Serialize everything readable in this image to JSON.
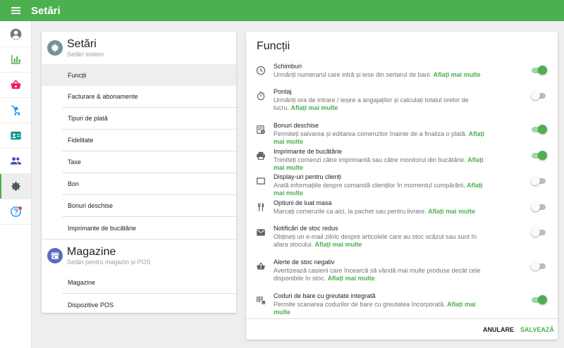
{
  "topbar": {
    "title": "Setări"
  },
  "colors": {
    "accent": "#4caf50",
    "nav_icons": [
      "#757575",
      "#4caf50",
      "#e91e63",
      "#2196f3",
      "#009688",
      "#3f51b5",
      "#455a64",
      "#2196f3"
    ],
    "section_settings": "#78909c",
    "section_stores": "#5c6bc0"
  },
  "nav": {
    "items": [
      "account-icon",
      "reports-icon",
      "items-icon",
      "employees-icon",
      "customers-icon",
      "users-icon",
      "settings-icon",
      "help-icon"
    ]
  },
  "settings": {
    "title": "Setări",
    "subtitle": "Setări sistem",
    "items": [
      "Funcții",
      "Facturare & abonamente",
      "Tipuri de plată",
      "Fidelitate",
      "Taxe",
      "Bon",
      "Bonuri deschise",
      "Imprimante de bucătărie"
    ]
  },
  "stores": {
    "title": "Magazine",
    "subtitle": "Setări pentru magazin și POS",
    "items": [
      "Magazine",
      "Dispozitive POS"
    ]
  },
  "functions": {
    "title": "Funcții",
    "learn_more": "Aflați mai multe",
    "items": [
      {
        "title": "Schimburi",
        "desc": "Urmăriți numerarul care intră și iese din sertarul de bani.",
        "enabled": true,
        "icon": "clock-icon"
      },
      {
        "title": "Pontaj",
        "desc": "Urmăriți ora de intrare / ieșire a angajaților și calculați totalul orelor de lucru.",
        "enabled": false,
        "icon": "stopwatch-icon"
      },
      {
        "title": "Bonuri deschise",
        "desc": "Permiteți salvarea și editarea comenzilor înainte de a finaliza o plată.",
        "enabled": true,
        "icon": "open-ticket-icon"
      },
      {
        "title": "Imprimante de bucătărie",
        "desc": "Trimiteți comenzi către imprimantă sau către monitorul din bucătărie.",
        "enabled": true,
        "icon": "printer-icon"
      },
      {
        "title": "Display-uri pentru clienți",
        "desc": "Arată informațiile despre comandă clienților în momentul cumpărării.",
        "enabled": false,
        "icon": "display-icon"
      },
      {
        "title": "Optiuni de luat masa",
        "desc": "Marcați comenzile ca aici, la pachet sau pentru livrare.",
        "enabled": false,
        "icon": "dining-icon"
      },
      {
        "title": "Notificări de stoc redus",
        "desc": "Obțineți un e-mail zilnic despre articolele care au stoc scăzut sau sunt în afara stocului.",
        "enabled": false,
        "icon": "mail-icon"
      },
      {
        "title": "Alerte de stoc negativ",
        "desc": "Avertizează casierii care încearcă să vândă mai multe produse decât cele disponibile în stoc.",
        "enabled": false,
        "icon": "basket-alert-icon"
      },
      {
        "title": "Coduri de bare cu greutate integrată",
        "desc": "Permite scanarea codurilor de bare cu greutatea încorporată.",
        "enabled": true,
        "icon": "barcode-weight-icon"
      }
    ],
    "cancel_label": "ANULARE",
    "save_label": "SALVEAZĂ"
  }
}
